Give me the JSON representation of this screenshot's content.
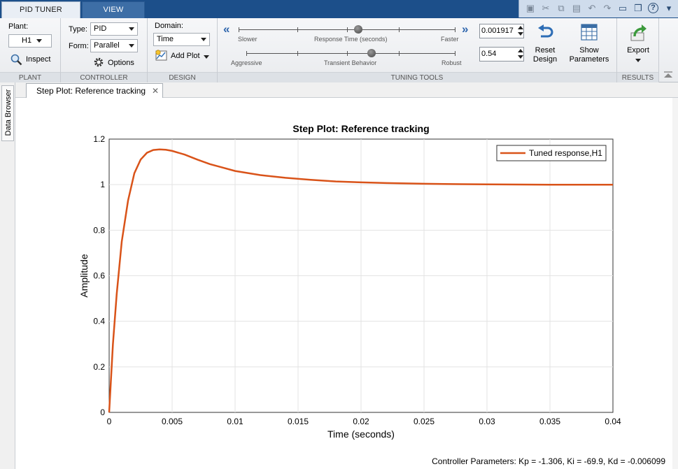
{
  "window": {
    "tabs": [
      {
        "label": "PID TUNER"
      },
      {
        "label": "VIEW"
      }
    ]
  },
  "plant": {
    "label": "Plant:",
    "value": "H1",
    "inspect": "Inspect",
    "section": "PLANT"
  },
  "controller": {
    "type_label": "Type:",
    "type_value": "PID",
    "form_label": "Form:",
    "form_value": "Parallel",
    "options": "Options",
    "section": "CONTROLLER"
  },
  "design": {
    "domain_label": "Domain:",
    "domain_value": "Time",
    "add_plot": "Add Plot",
    "section": "DESIGN"
  },
  "tuning": {
    "slower": "Slower",
    "response_time": "Response Time (seconds)",
    "faster": "Faster",
    "aggressive": "Aggressive",
    "transient": "Transient Behavior",
    "robust": "Robust",
    "response_value": "0.001917",
    "transient_value": "0.54",
    "section": "TUNING TOOLS",
    "response_knob_fraction": 0.55,
    "transient_knob_fraction": 0.6
  },
  "reset": {
    "line1": "Reset",
    "line2": "Design"
  },
  "show_params": {
    "line1": "Show",
    "line2": "Parameters"
  },
  "results": {
    "export": "Export",
    "section": "RESULTS"
  },
  "sidebar": {
    "data_browser": "Data Browser"
  },
  "document": {
    "tab_title": "Step Plot: Reference tracking"
  },
  "status": {
    "text": "Controller Parameters: Kp = -1.306, Ki = -69.9, Kd = -0.006099"
  },
  "chart_data": {
    "type": "line",
    "title": "Step Plot: Reference tracking",
    "xlabel": "Time (seconds)",
    "ylabel": "Amplitude",
    "xlim": [
      0,
      0.04
    ],
    "ylim": [
      0,
      1.2
    ],
    "xticks": [
      "0",
      "0.005",
      "0.01",
      "0.015",
      "0.02",
      "0.025",
      "0.03",
      "0.035",
      "0.04"
    ],
    "yticks": [
      "0",
      "0.2",
      "0.4",
      "0.6",
      "0.8",
      "1",
      "1.2"
    ],
    "grid": true,
    "legend": "top-right",
    "series": [
      {
        "name": "Tuned response,H1",
        "color": "#d95319",
        "x": [
          0,
          0.0003,
          0.0006,
          0.001,
          0.0015,
          0.002,
          0.0025,
          0.003,
          0.0035,
          0.004,
          0.0045,
          0.005,
          0.006,
          0.007,
          0.008,
          0.009,
          0.01,
          0.012,
          0.014,
          0.016,
          0.018,
          0.02,
          0.022,
          0.025,
          0.028,
          0.03,
          0.035,
          0.04
        ],
        "y": [
          0,
          0.3,
          0.52,
          0.75,
          0.93,
          1.05,
          1.11,
          1.14,
          1.152,
          1.155,
          1.153,
          1.148,
          1.132,
          1.11,
          1.09,
          1.075,
          1.06,
          1.042,
          1.03,
          1.021,
          1.014,
          1.01,
          1.007,
          1.004,
          1.002,
          1.001,
          1.0,
          1.0
        ]
      }
    ]
  }
}
